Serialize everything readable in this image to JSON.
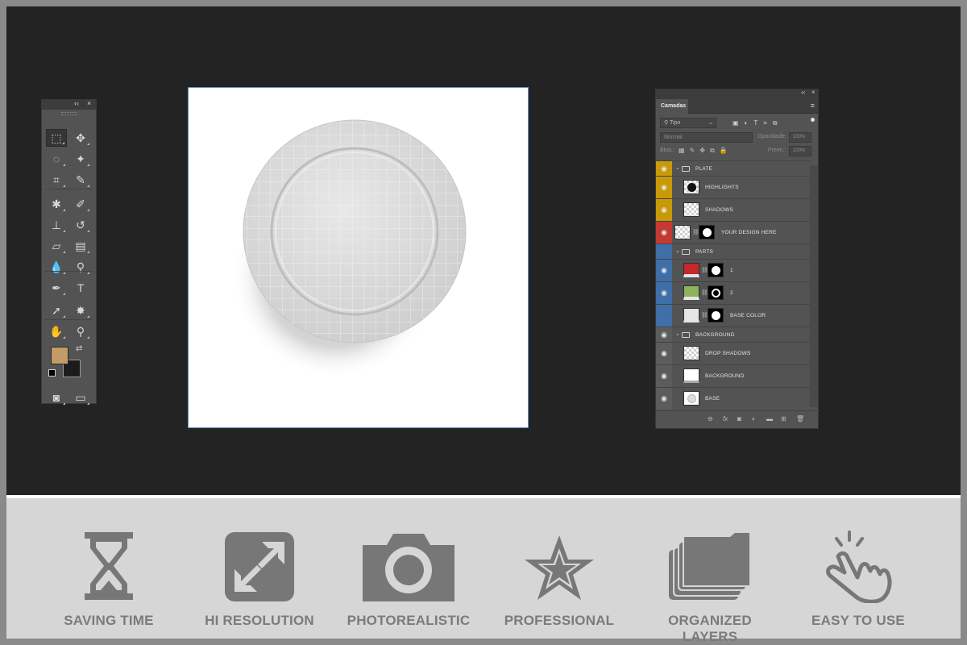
{
  "tools_panel": {
    "collapse_label": "‹‹",
    "close_label": "×",
    "tools": [
      {
        "name": "rectangular-marquee-icon",
        "glyph": "⬚"
      },
      {
        "name": "move-icon",
        "glyph": "✥"
      },
      {
        "name": "lasso-icon",
        "glyph": "◌"
      },
      {
        "name": "magic-wand-icon",
        "glyph": "✦"
      },
      {
        "name": "crop-icon",
        "glyph": "⌗"
      },
      {
        "name": "eyedropper-icon",
        "glyph": "✎"
      },
      {
        "name": "healing-brush-icon",
        "glyph": "✱"
      },
      {
        "name": "brush-icon",
        "glyph": "✐"
      },
      {
        "name": "clone-stamp-icon",
        "glyph": "⊥"
      },
      {
        "name": "history-brush-icon",
        "glyph": "↺"
      },
      {
        "name": "eraser-icon",
        "glyph": "▱"
      },
      {
        "name": "gradient-icon",
        "glyph": "▤"
      },
      {
        "name": "blur-icon",
        "glyph": "💧"
      },
      {
        "name": "dodge-icon",
        "glyph": "⚲"
      },
      {
        "name": "pen-icon",
        "glyph": "✒"
      },
      {
        "name": "type-icon",
        "glyph": "T"
      },
      {
        "name": "path-selection-icon",
        "glyph": "➚"
      },
      {
        "name": "custom-shape-icon",
        "glyph": "✸"
      },
      {
        "name": "hand-icon",
        "glyph": "✋"
      },
      {
        "name": "zoom-icon",
        "glyph": "⚲"
      },
      {
        "name": "quick-mask-icon",
        "glyph": "◙"
      },
      {
        "name": "screen-mode-icon",
        "glyph": "▭"
      }
    ],
    "foreground_color": "#c49a66",
    "background_color": "#1c1c1c"
  },
  "layers_panel": {
    "collapse_label": "‹‹",
    "close_label": "×",
    "tab_label": "Camadas",
    "menu_label": "≡",
    "filter_value": "Tipo",
    "blend_mode": "Normal",
    "opacity_label": "Opacidade:",
    "opacity_value": "100%",
    "lock_label": "Bloq.:",
    "fill_label": "Preen.:",
    "fill_value": "100%",
    "layers": [
      {
        "name": "PLATE",
        "kind": "group",
        "color": "#c99a07"
      },
      {
        "name": "HIGHLIGHTS",
        "kind": "layer",
        "color": "#c99a07"
      },
      {
        "name": "SHADOWS",
        "kind": "layer",
        "color": "#c99a07"
      },
      {
        "name": "YOUR DESIGN HERE",
        "kind": "smart",
        "color": "#c43a32"
      },
      {
        "name": "PARTS",
        "kind": "group",
        "color": "#3f6fa6"
      },
      {
        "name": "1",
        "kind": "fill",
        "color": "#3f6fa6",
        "swatch": "#c4282a"
      },
      {
        "name": "2",
        "kind": "fill",
        "color": "#3f6fa6",
        "swatch": "#8fb25c"
      },
      {
        "name": "BASE COLOR",
        "kind": "fill",
        "color": "#3f6fa6",
        "swatch": "#e6e6e6"
      },
      {
        "name": "BACKGROUND",
        "kind": "group",
        "color": ""
      },
      {
        "name": "DROP SHADOWS",
        "kind": "layer",
        "color": ""
      },
      {
        "name": "BACKGROUND",
        "kind": "layer",
        "color": ""
      },
      {
        "name": "BASE",
        "kind": "layer",
        "color": ""
      }
    ]
  },
  "features": [
    {
      "label": "SAVING TIME",
      "icon": "hourglass-icon"
    },
    {
      "label": "HI RESOLUTION",
      "icon": "expand-arrows-icon"
    },
    {
      "label": "PHOTOREALISTIC",
      "icon": "camera-icon"
    },
    {
      "label": "PROFESSIONAL",
      "icon": "star-icon"
    },
    {
      "label": "ORGANIZED LAYERS",
      "icon": "stacked-folders-icon"
    },
    {
      "label": "EASY TO USE",
      "icon": "hand-click-icon"
    }
  ],
  "colors": {
    "feature_icon": "#777777",
    "feature_text": "#7b7b7b",
    "workspace": "#232323",
    "panel": "#535353"
  }
}
